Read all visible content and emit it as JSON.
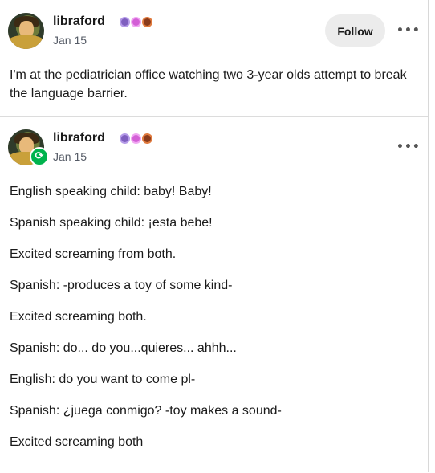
{
  "post1": {
    "username": "libraford",
    "date": "Jan 15",
    "follow_label": "Follow",
    "text": "I'm at the pediatrician office watching two 3-year olds attempt to break the language barrier."
  },
  "post2": {
    "username": "libraford",
    "date": "Jan 15",
    "lines": [
      "English speaking child: baby! Baby!",
      "Spanish speaking child: ¡esta bebe!",
      "Excited screaming from both.",
      "Spanish: -produces a toy of some kind-",
      "Excited screaming both.",
      "Spanish: do... do you...quieres... ahhh...",
      "English: do you want to come pl-",
      "Spanish: ¿juega conmigo? -toy makes a sound-",
      "Excited screaming both"
    ]
  },
  "icons": {
    "more": "more-horizontal-icon",
    "reblog": "reblog-icon",
    "reblog_glyph": "⟳"
  },
  "colors": {
    "reblog_badge": "#00b34d",
    "follow_bg": "#ececec",
    "date_text": "#555b66"
  }
}
